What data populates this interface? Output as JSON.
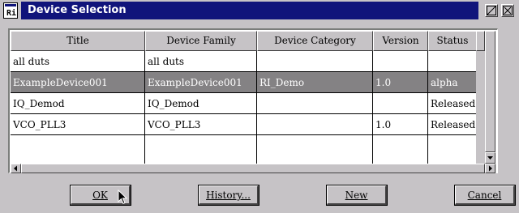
{
  "window": {
    "title": "Device Selection",
    "icons": {
      "app": "terminal-window-icon",
      "maximize": "maximize-icon",
      "close": "close-icon"
    }
  },
  "table": {
    "columns": [
      "Title",
      "Device Family",
      "Device Category",
      "Version",
      "Status"
    ],
    "rows": [
      {
        "cells": [
          "all duts",
          "all duts",
          "",
          "",
          ""
        ],
        "selected": false
      },
      {
        "cells": [
          "ExampleDevice001",
          "ExampleDevice001",
          "RI_Demo",
          "1.0",
          "alpha"
        ],
        "selected": true
      },
      {
        "cells": [
          "IQ_Demod",
          "IQ_Demod",
          "",
          "",
          "Released"
        ],
        "selected": false
      },
      {
        "cells": [
          "VCO_PLL3",
          "VCO_PLL3",
          "",
          "1.0",
          "Released"
        ],
        "selected": false
      },
      {
        "cells": [
          "",
          "",
          "",
          "",
          ""
        ],
        "selected": false
      }
    ],
    "selected_row_bg": "#848284"
  },
  "buttons": {
    "ok": "OK",
    "history": "History...",
    "new": "New",
    "cancel": "Cancel"
  },
  "colors": {
    "titlebar": "#10147b",
    "window_bg": "#c6c3c6"
  }
}
